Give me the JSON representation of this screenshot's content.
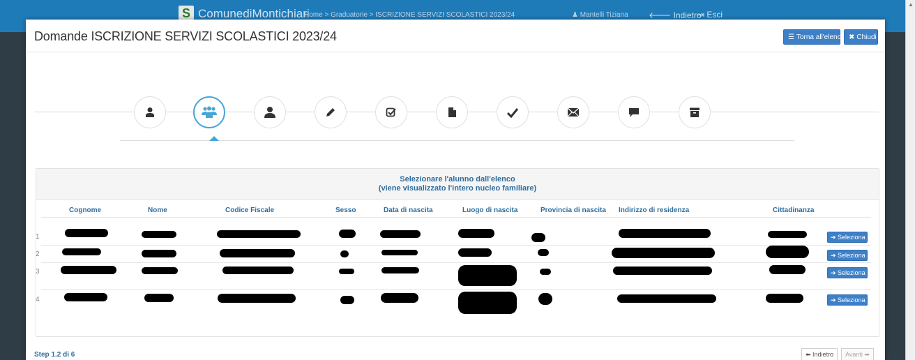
{
  "background": {
    "brand": "ComunediMontichiari",
    "breadcrumb": "Home > Graduatorie > ISCRIZIONE SERVIZI SCOLASTICI 2023/24",
    "user": "Mantelli Tiziana",
    "back": "Indietro",
    "exit": "Esci"
  },
  "modal": {
    "title": "Domande ISCRIZIONE SERVIZI SCOLASTICI 2023/24",
    "torna_label": "Torna all'elenco",
    "chiudi_label": "Chiudi"
  },
  "stepper": {
    "steps": [
      "user-icon",
      "group-icon",
      "user-solid-icon",
      "pencil-icon",
      "check-square-icon",
      "file-icon",
      "checkmark-icon",
      "envelope-icon",
      "comment-icon",
      "archive-icon"
    ],
    "active_step": 2,
    "accent": "#48a5d8"
  },
  "panel": {
    "heading_line1": "Selezionare l'alunno dall'elenco",
    "heading_line2": "(viene visualizzato l'intero nucleo familiare)"
  },
  "table": {
    "columns": [
      "Cognome",
      "Nome",
      "Codice Fiscale",
      "Sesso",
      "Data di nascita",
      "Luogo di nascita",
      "Provincia di nascita",
      "Indirizzo di residenza",
      "Cittadinanza"
    ],
    "rows": [
      {
        "num": "1",
        "action": "Seleziona"
      },
      {
        "num": "2",
        "action": "Seleziona"
      },
      {
        "num": "3",
        "action": "Seleziona"
      },
      {
        "num": "4",
        "action": "Seleziona"
      }
    ]
  },
  "footer": {
    "step_label": "Step 1.2 di 6",
    "prev_label": "Indietro",
    "next_label": "Avanti"
  },
  "colors": {
    "primary": "#3d80c8",
    "header_text": "#2e6e9e"
  }
}
